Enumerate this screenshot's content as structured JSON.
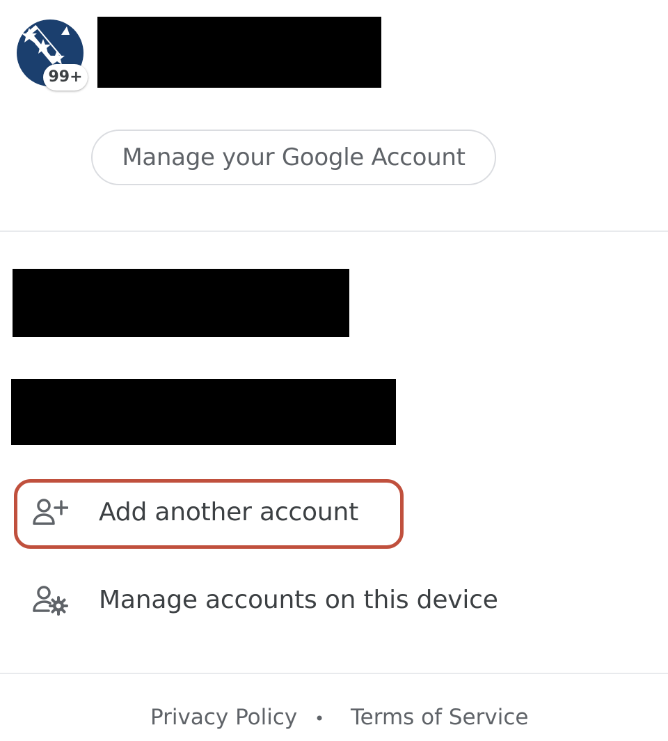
{
  "account": {
    "avatar_icon": "stars-logo-avatar",
    "notification_badge": "99+",
    "manage_button_label": "Manage your Google Account"
  },
  "actions": {
    "add_account_label": "Add another account",
    "add_account_icon": "person-add-icon",
    "manage_accounts_label": "Manage accounts on this device",
    "manage_accounts_icon": "person-settings-icon"
  },
  "footer": {
    "privacy_label": "Privacy Policy",
    "separator": "•",
    "terms_label": "Terms of Service"
  },
  "colors": {
    "avatar_blue": "#1b3f6e",
    "highlight_border": "#c0503d",
    "text_primary": "#3c4043",
    "text_secondary": "#5f6368",
    "divider": "#e8eaed"
  }
}
